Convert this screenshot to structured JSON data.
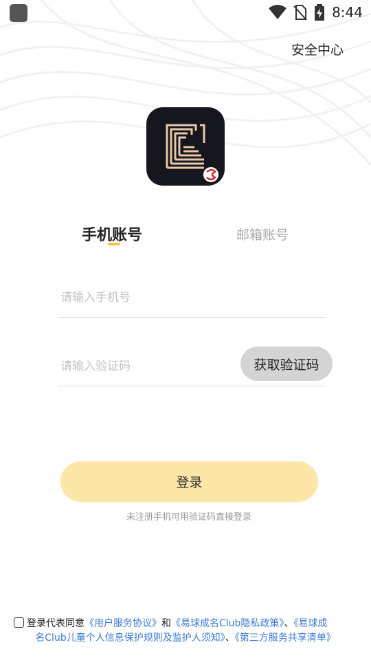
{
  "status_bar": {
    "time": "8:44",
    "icons": [
      "app-icon",
      "wifi-icon",
      "no-sim-icon",
      "battery-charging-icon"
    ]
  },
  "header": {
    "security_center": "安全中心"
  },
  "logo": {
    "name": "app-logo"
  },
  "tabs": [
    {
      "label": "手机账号",
      "active": true
    },
    {
      "label": "邮箱账号",
      "active": false
    }
  ],
  "form": {
    "phone_placeholder": "请输入手机号",
    "code_placeholder": "请输入验证码",
    "get_code_label": "获取验证码"
  },
  "login": {
    "button_label": "登录",
    "hint": "未注册手机可用验证码直接登录"
  },
  "agreement": {
    "prefix": "登录代表同意",
    "link1": "《用户服务协议》",
    "and": "和",
    "link2": "《易球成名Club隐私政策》",
    "sep1": "、",
    "link3a": "《易球成",
    "link3b": "名Club儿童个人信息保护规则及监护人须知》",
    "sep2": "、",
    "link4": "《第三方服务共享清单》"
  },
  "colors": {
    "accent": "#f5c24a",
    "login_button": "#fce6a8",
    "link": "#3a7bd5",
    "code_button": "#d4d4d4"
  }
}
